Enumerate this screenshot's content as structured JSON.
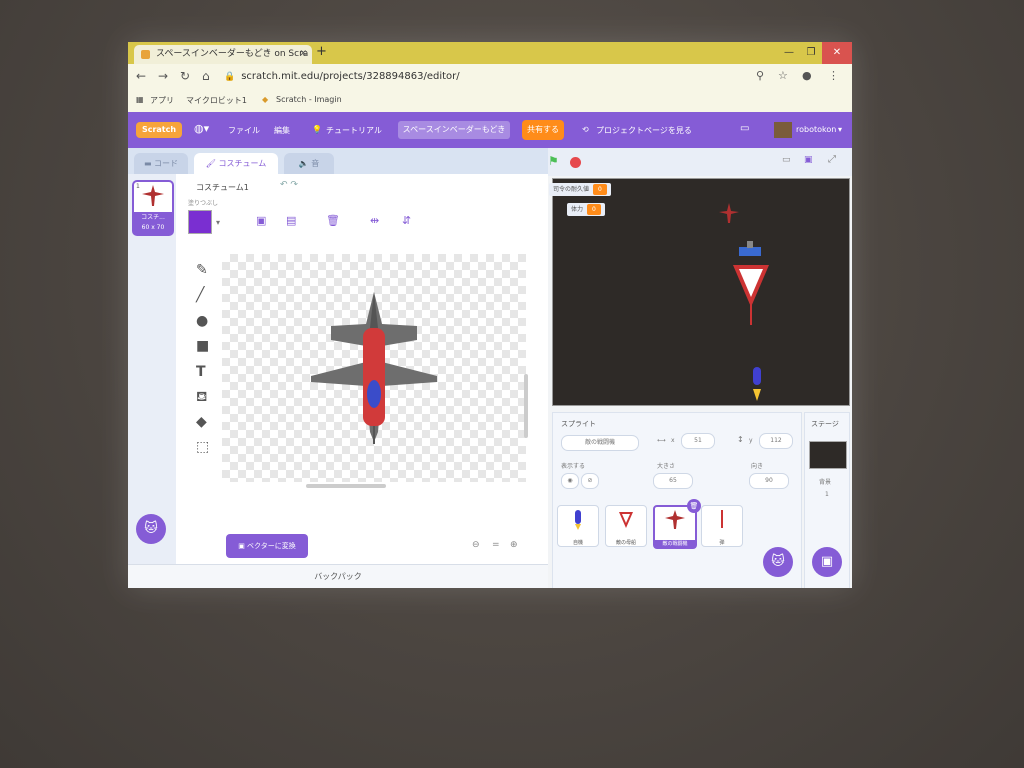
{
  "browser": {
    "tab_title": "スペースインベーダーもどき on Scra",
    "url": "scratch.mit.edu/projects/328894863/editor/",
    "bookmarks": [
      "アプリ",
      "マイクロビット1",
      "Scratch - Imagin"
    ]
  },
  "menu": {
    "logo": "Scratch",
    "file": "ファイル",
    "edit": "編集",
    "tutorials": "チュートリアル",
    "project_title": "スペースインベーダーもどき",
    "share": "共有する",
    "see_project_page": "プロジェクトページを見る",
    "username": "robotokon"
  },
  "tabs": {
    "code": "コード",
    "costumes": "コスチューム",
    "sounds": "音"
  },
  "costume_list": [
    {
      "index": "1",
      "name": "コスチ...",
      "size": "60 x 70"
    }
  ],
  "paint": {
    "costume_name": "コスチューム1",
    "fill_label": "塗りつぶし",
    "fill_color": "#7a2fd1",
    "convert_button": "ベクターに変換",
    "zoom_reset": "="
  },
  "monitors": [
    {
      "label": "司令の耐久値",
      "value": "0"
    },
    {
      "label": "体力",
      "value": "0"
    }
  ],
  "sprite_info": {
    "label": "スプライト",
    "name": "敵の戦闘機",
    "x_label": "x",
    "x": "51",
    "y_label": "y",
    "y": "112",
    "show_label": "表示する",
    "size_label": "大きさ",
    "size": "65",
    "direction_label": "向き",
    "direction": "90"
  },
  "sprites": [
    {
      "name": "自機",
      "selected": false
    },
    {
      "name": "敵の母船",
      "selected": false
    },
    {
      "name": "敵の戦闘機",
      "selected": true
    },
    {
      "name": "弾",
      "selected": false
    }
  ],
  "stage_panel": {
    "label": "ステージ",
    "backdrops_label": "背景",
    "backdrops_count": "1"
  },
  "backpack": "バックパック"
}
